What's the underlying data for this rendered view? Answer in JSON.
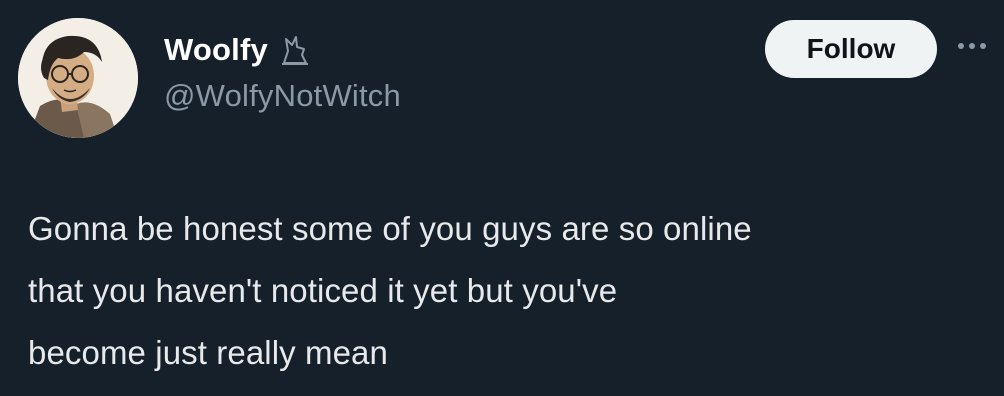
{
  "user": {
    "display_name": "Woolfy",
    "handle": "@WolfyNotWitch"
  },
  "actions": {
    "follow_label": "Follow"
  },
  "tweet": {
    "text": "Gonna be honest some of you guys are so online\nthat you haven't noticed it yet but you've\nbecome just really mean"
  },
  "icons": {
    "badge": "wolf-icon",
    "more": "more-options-icon"
  },
  "colors": {
    "background": "#15202b",
    "primary_text": "#e7e9ea",
    "secondary_text": "#8b98a5",
    "follow_button_bg": "#eff3f4",
    "follow_button_text": "#0f1419"
  }
}
